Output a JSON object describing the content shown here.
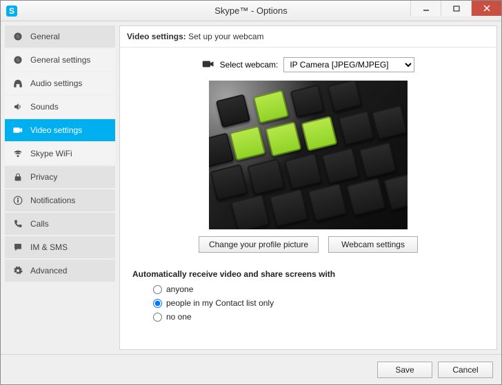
{
  "window": {
    "title": "Skype™ - Options",
    "app_icon_letter": "S"
  },
  "sidebar": {
    "items": [
      {
        "label": "General",
        "icon": "skype",
        "header": true
      },
      {
        "label": "General settings",
        "icon": "skype"
      },
      {
        "label": "Audio settings",
        "icon": "headphones"
      },
      {
        "label": "Sounds",
        "icon": "speaker"
      },
      {
        "label": "Video settings",
        "icon": "camera",
        "active": true
      },
      {
        "label": "Skype WiFi",
        "icon": "wifi"
      },
      {
        "label": "Privacy",
        "icon": "lock",
        "header": true
      },
      {
        "label": "Notifications",
        "icon": "info",
        "header": true
      },
      {
        "label": "Calls",
        "icon": "phone",
        "header": true
      },
      {
        "label": "IM & SMS",
        "icon": "chat",
        "header": true
      },
      {
        "label": "Advanced",
        "icon": "gear",
        "header": true
      }
    ]
  },
  "content": {
    "header_strong": "Video settings:",
    "header_rest": " Set up your webcam",
    "select_label": "Select webcam:",
    "select_value": "IP Camera [JPEG/MJPEG]",
    "change_picture_btn": "Change your profile picture",
    "webcam_settings_btn": "Webcam settings",
    "auto_receive_title": "Automatically receive video and share screens with",
    "radios": {
      "anyone": "anyone",
      "contacts": "people in my Contact list only",
      "noone": "no one",
      "selected": "contacts"
    }
  },
  "footer": {
    "save": "Save",
    "cancel": "Cancel"
  }
}
